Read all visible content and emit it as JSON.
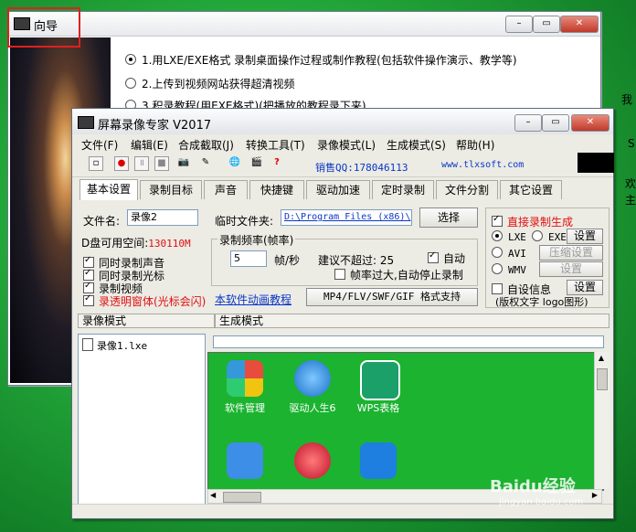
{
  "desktop": {
    "right_text_1": "我",
    "right_text_2": "S",
    "right_text_3": "欢",
    "right_text_4": "主"
  },
  "back_window": {
    "title": "向导",
    "options": [
      "1.用LXE/EXE格式 录制桌面操作过程或制作教程(包括软件操作演示、教学等)",
      "2.上传到视频网站获得超清视频",
      "3.积录教程(用EXE格式)(把播放的教程录下来)"
    ]
  },
  "main_window": {
    "title": "屏幕录像专家 V2017",
    "menu": [
      "文件(F)",
      "编辑(E)",
      "合成截取(J)",
      "转换工具(T)",
      "录像模式(L)",
      "生成模式(S)",
      "帮助(H)"
    ],
    "qq": "销售QQ:178046113",
    "site": "www.tlxsoft.com",
    "tabs": [
      "基本设置",
      "录制目标",
      "声音",
      "快捷键",
      "驱动加速",
      "定时录制",
      "文件分割",
      "其它设置"
    ],
    "filename_label": "文件名:",
    "filename_value": "录像2",
    "tempdir_label": "临时文件夹:",
    "tempdir_value": "D:\\Program Files (x86)\\",
    "browse_btn": "选择",
    "disk_label": "D盘可用空间:",
    "disk_value": "130110M",
    "checks": [
      {
        "label": "同时录制声音",
        "checked": true
      },
      {
        "label": "同时录制光标",
        "checked": true
      },
      {
        "label": "录制视频",
        "checked": true
      },
      {
        "label": "录透明窗体(光标会闪)",
        "checked": true
      }
    ],
    "anim_link": "本软件动画教程",
    "freq_group": "录制频率(帧率)",
    "freq_value": "5",
    "freq_unit": "帧/秒",
    "freq_hint": "建议不超过: 25",
    "auto_label": "自动",
    "stop_label": "帧率过大,自动停止录制",
    "format_btn": "MP4/FLV/SWF/GIF  格式支持",
    "direct_label": "直接录制生成",
    "lxe": "LXE",
    "exe": "EXE",
    "avi": "AVI",
    "wmv": "WMV",
    "setting": "设置",
    "compress": "压缩设置",
    "custom_info": "自设信息",
    "copyright": "(版权文字 logo图形)",
    "mode_hdr": "录像模式",
    "gen_hdr": "生成模式",
    "file_item": "录像1.lxe",
    "apps": [
      "软件管理",
      "驱动人生6",
      "WPS表格"
    ]
  },
  "watermark": "Baidu经验",
  "watermark_sub": "jingyan.baidu.com",
  "colors": {
    "red": "#e01010",
    "blue": "#0a36c8",
    "green": "#1bb330"
  }
}
